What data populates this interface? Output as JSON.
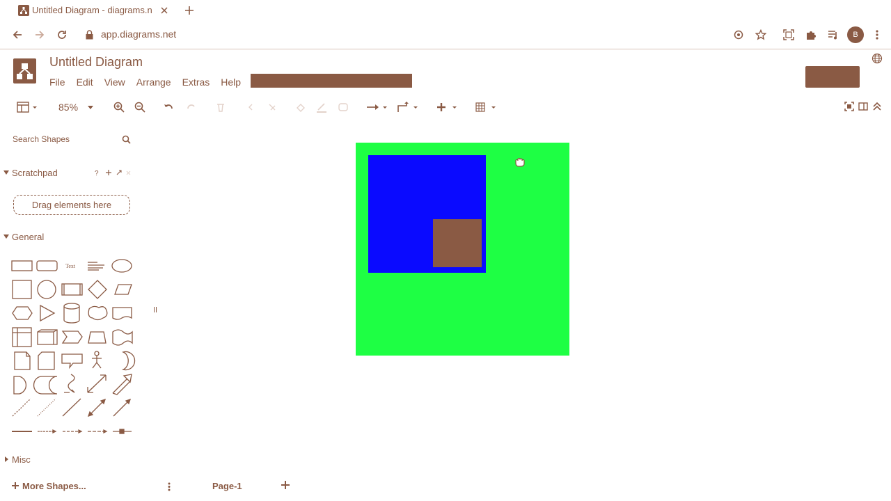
{
  "browser": {
    "tab_title": "Untitled Diagram - diagrams.n",
    "url": "app.diagrams.net",
    "avatar_letter": "B"
  },
  "app": {
    "doc_title": "Untitled Diagram",
    "menu": [
      "File",
      "Edit",
      "View",
      "Arrange",
      "Extras",
      "Help"
    ]
  },
  "toolbar": {
    "zoom": "85%"
  },
  "sidebar": {
    "search_placeholder": "Search Shapes",
    "scratchpad_title": "Scratchpad",
    "scratchpad_drop": "Drag elements here",
    "general_title": "General",
    "misc_title": "Misc",
    "more_shapes": "More Shapes...",
    "text_shape_label": "Text"
  },
  "footer": {
    "page_tab": "Page-1"
  },
  "canvas": {
    "shapes": [
      {
        "name": "outer-rect",
        "fill": "#1eff44"
      },
      {
        "name": "inner-rect",
        "fill": "#0a0aff"
      },
      {
        "name": "small-rect",
        "fill": "#8a5a44"
      }
    ]
  },
  "colors": {
    "accent": "#8a5a44",
    "green_fill": "#1eff44",
    "blue_fill": "#0a0aff"
  }
}
